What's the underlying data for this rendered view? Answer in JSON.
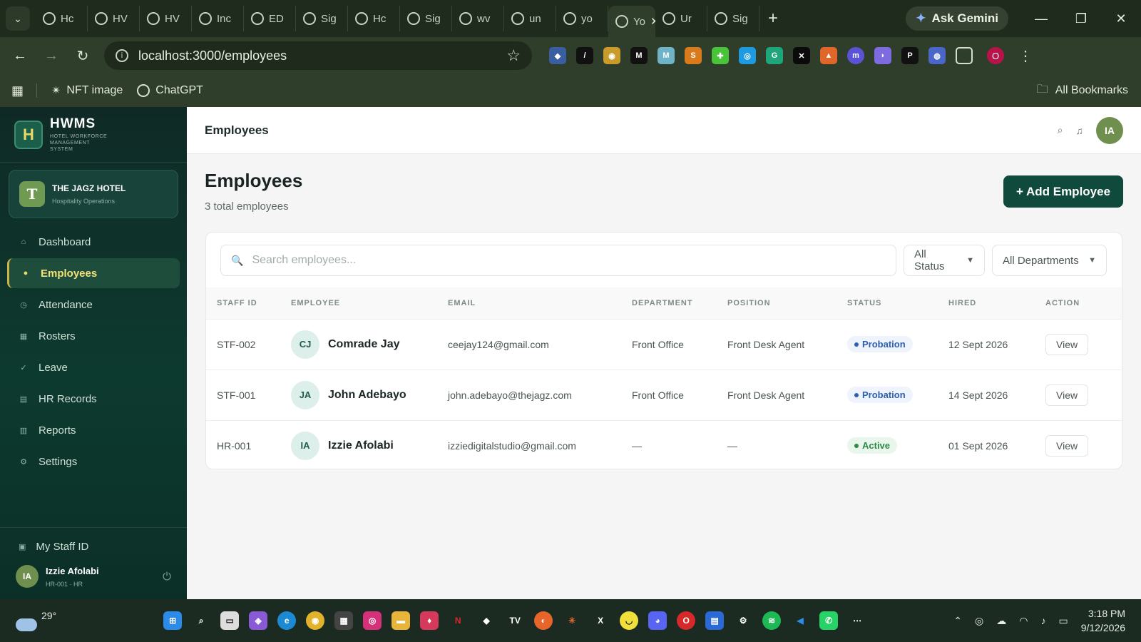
{
  "browser": {
    "tabs": [
      {
        "label": "Hc",
        "icon": "page-icon"
      },
      {
        "label": "HV",
        "icon": "globe-icon"
      },
      {
        "label": "HV",
        "icon": "globe-icon"
      },
      {
        "label": "Inc",
        "icon": "globe-icon"
      },
      {
        "label": "ED",
        "icon": "cloud-icon"
      },
      {
        "label": "Sig",
        "icon": "openai-icon"
      },
      {
        "label": "Hc",
        "icon": "chart-icon"
      },
      {
        "label": "Sig",
        "icon": "openai-icon"
      },
      {
        "label": "wv",
        "icon": "openai-icon"
      },
      {
        "label": "un",
        "icon": "globe-icon"
      },
      {
        "label": "yo",
        "icon": "google-icon"
      },
      {
        "label": "Yo",
        "icon": "openai-icon"
      },
      {
        "label": "Ur",
        "icon": "bolt-icon"
      },
      {
        "label": "Sig",
        "icon": "globe-icon"
      }
    ],
    "active_tab_close": "✕",
    "new_tab": "+",
    "ask_gemini": "Ask Gemini",
    "url": "localhost:3000/employees",
    "bookmarks": [
      {
        "label": "NFT image"
      },
      {
        "label": "ChatGPT"
      }
    ],
    "all_bookmarks": "All Bookmarks",
    "profile_initial": "O"
  },
  "sidebar": {
    "brand_name": "HWMS",
    "brand_sub": "HOTEL WORKFORCE MANAGEMENT SYSTEM",
    "logo_letter": "H",
    "hotel": {
      "initial": "T",
      "name": "THE JAGZ HOTEL",
      "sub": "Hospitality Operations"
    },
    "items": [
      {
        "label": "Dashboard",
        "icon": "home-icon",
        "glyph": "⌂"
      },
      {
        "label": "Employees",
        "icon": "user-icon",
        "glyph": "●",
        "active": true
      },
      {
        "label": "Attendance",
        "icon": "clock-icon",
        "glyph": "◷"
      },
      {
        "label": "Rosters",
        "icon": "grid-icon",
        "glyph": "▦"
      },
      {
        "label": "Leave",
        "icon": "check-icon",
        "glyph": "✓"
      },
      {
        "label": "HR Records",
        "icon": "records-icon",
        "glyph": "▤"
      },
      {
        "label": "Reports",
        "icon": "reports-icon",
        "glyph": "▥"
      },
      {
        "label": "Settings",
        "icon": "gear-icon",
        "glyph": "⚙"
      }
    ],
    "my_staff_id": "My Staff ID",
    "user": {
      "initials": "IA",
      "name": "Izzie Afolabi",
      "sub": "HR-001 · HR"
    }
  },
  "topbar": {
    "title": "Employees",
    "avatar_initials": "IA"
  },
  "page": {
    "title": "Employees",
    "count_text": "3 total employees",
    "add_button": "+ Add Employee"
  },
  "filters": {
    "search_placeholder": "Search employees...",
    "status_value": "All Status",
    "department_value": "All Departments"
  },
  "table": {
    "columns": [
      "STAFF ID",
      "EMPLOYEE",
      "EMAIL",
      "DEPARTMENT",
      "POSITION",
      "STATUS",
      "HIRED",
      "ACTION"
    ],
    "rows": [
      {
        "staff_id": "STF-002",
        "initials": "CJ",
        "name": "Comrade Jay",
        "email": "ceejay124@gmail.com",
        "department": "Front Office",
        "position": "Front Desk Agent",
        "status": "Probation",
        "hired": "12 Sept 2026",
        "action": "View"
      },
      {
        "staff_id": "STF-001",
        "initials": "JA",
        "name": "John Adebayo",
        "email": "john.adebayo@thejagz.com",
        "department": "Front Office",
        "position": "Front Desk Agent",
        "status": "Probation",
        "hired": "14 Sept 2026",
        "action": "View"
      },
      {
        "staff_id": "HR-001",
        "initials": "IA",
        "name": "Izzie Afolabi",
        "email": "izziedigitalstudio@gmail.com",
        "department": "—",
        "position": "—",
        "status": "Active",
        "hired": "01 Sept 2026",
        "action": "View"
      }
    ]
  },
  "taskbar": {
    "temperature": "29°",
    "time": "3:18 PM",
    "date": "9/12/2026"
  },
  "colors": {
    "brand_dark": "#0f4a3c",
    "sidebar_bg": "#0f2a26",
    "accent_gold": "#e8d96a",
    "probation": "#2e5fae",
    "active": "#2d8a45"
  }
}
